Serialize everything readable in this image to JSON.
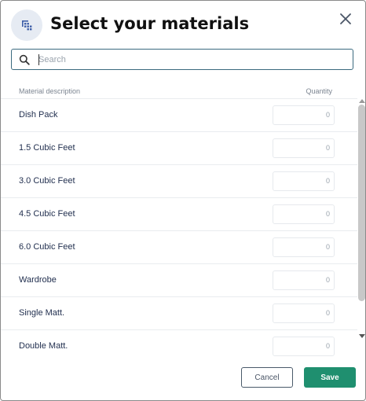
{
  "dialog": {
    "title": "Select your materials",
    "header_icon": "materials-grid-icon",
    "close_icon": "close-icon"
  },
  "search": {
    "placeholder": "Search",
    "value": "",
    "icon": "search-icon"
  },
  "table": {
    "columns": {
      "description": "Material description",
      "quantity": "Quantity"
    },
    "rows": [
      {
        "label": "Dish Pack",
        "quantity": "0"
      },
      {
        "label": "1.5 Cubic Feet",
        "quantity": "0"
      },
      {
        "label": "3.0 Cubic Feet",
        "quantity": "0"
      },
      {
        "label": "4.5 Cubic Feet",
        "quantity": "0"
      },
      {
        "label": "6.0 Cubic Feet",
        "quantity": "0"
      },
      {
        "label": "Wardrobe",
        "quantity": "0"
      },
      {
        "label": "Single Matt.",
        "quantity": "0"
      },
      {
        "label": "Double Matt.",
        "quantity": "0"
      }
    ]
  },
  "footer": {
    "cancel_label": "Cancel",
    "save_label": "Save"
  },
  "colors": {
    "accent": "#1f8f6f",
    "text_primary": "#1f2d4d",
    "header_icon_bg": "#e6ebf3",
    "search_border": "#3b6a7f"
  }
}
